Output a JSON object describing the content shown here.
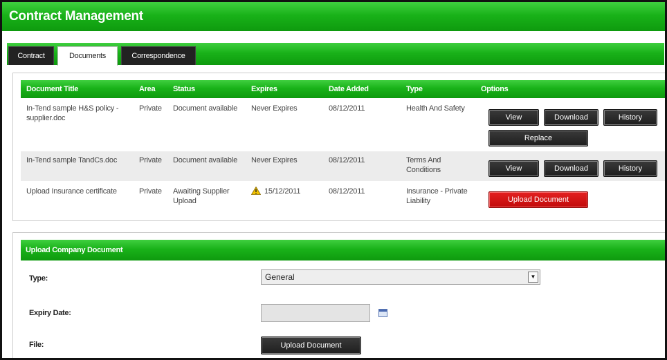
{
  "app": {
    "title": "Contract Management"
  },
  "tabs": [
    {
      "label": "Contract",
      "active": false
    },
    {
      "label": "Documents",
      "active": true
    },
    {
      "label": "Correspondence",
      "active": false
    }
  ],
  "documents_table": {
    "columns": [
      "Document Title",
      "Area",
      "Status",
      "Expires",
      "Date Added",
      "Type",
      "Options"
    ],
    "rows": [
      {
        "title": "In-Tend sample H&S policy - supplier.doc",
        "area": "Private",
        "status": "Document available",
        "expires": "Never Expires",
        "date_added": "08/12/2011",
        "type": "Health And Safety",
        "options": [
          "View",
          "Download",
          "History",
          "Replace"
        ]
      },
      {
        "title": "In-Tend sample TandCs.doc",
        "area": "Private",
        "status": "Document available",
        "expires": "Never Expires",
        "date_added": "08/12/2011",
        "type": "Terms And Conditions",
        "options": [
          "View",
          "Download",
          "History"
        ]
      },
      {
        "title": "Upload Insurance certificate",
        "area": "Private",
        "status": "Awaiting Supplier Upload",
        "expires": "15/12/2011",
        "expires_warning_icon": "warning-icon",
        "date_added": "08/12/2011",
        "type": "Insurance - Private Liability",
        "options": [
          "Upload Document"
        ]
      }
    ]
  },
  "upload_section": {
    "header": "Upload Company Document",
    "type_label": "Type:",
    "type_value": "General",
    "expiry_label": "Expiry Date:",
    "expiry_value": "",
    "file_label": "File:",
    "upload_button": "Upload Document",
    "calendar_icon": "calendar-icon"
  },
  "colors": {
    "header_green": "#19b219",
    "button_dark": "#222222",
    "button_red": "#d01010",
    "warning_yellow": "#f2c200"
  }
}
